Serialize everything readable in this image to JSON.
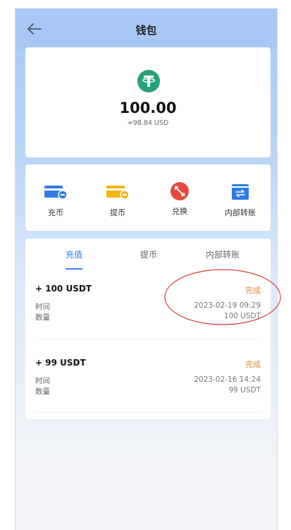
{
  "header": {
    "title": "钱包",
    "back_icon": "arrow-left-icon"
  },
  "balance": {
    "coin_icon": "tether-usdt-icon",
    "coin_color": "#26a17b",
    "amount": "100.00",
    "usd": "≈98.84 USD"
  },
  "actions": [
    {
      "label": "充币",
      "icon": "deposit-card-icon",
      "color": "#2f7be5"
    },
    {
      "label": "提币",
      "icon": "withdraw-card-icon",
      "color": "#f2b417"
    },
    {
      "label": "兑换",
      "icon": "exchange-icon",
      "color": "#e8493f"
    },
    {
      "label": "内部转账",
      "icon": "transfer-icon",
      "color": "#2f7be5"
    }
  ],
  "tabs": [
    {
      "label": "充值",
      "active": true
    },
    {
      "label": "提币",
      "active": false
    },
    {
      "label": "内部转账",
      "active": false
    }
  ],
  "records": [
    {
      "amount": "+ 100  USDT",
      "status": "完成",
      "time_label": "时间",
      "time": "2023-02-19 09:29",
      "qty_label": "数量",
      "qty": "100 USDT"
    },
    {
      "amount": "+ 99  USDT",
      "status": "完成",
      "time_label": "时间",
      "time": "2023-02-16 14:24",
      "qty_label": "数量",
      "qty": "99 USDT"
    }
  ],
  "colors": {
    "header": "#a8c7f5",
    "accent": "#2f7be5",
    "status": "#e08a2c",
    "annotation": "#d9403a"
  }
}
